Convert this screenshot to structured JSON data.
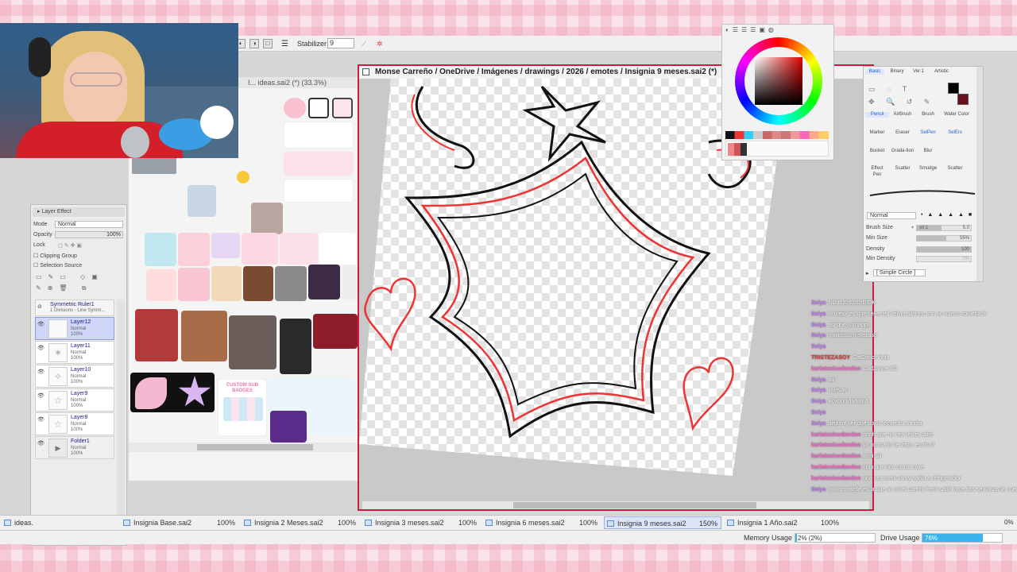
{
  "toolbar": {
    "stabilizer_label": "Stabilizer",
    "stabilizer_value": "9"
  },
  "ideas_window": {
    "title": "I... ideas.sai2 (*) (33.3%)",
    "badge_text": "CUSTOM SUB BADGES"
  },
  "main_window": {
    "title": "Monse Carreño / OneDrive / Imágenes / drawings / 2026 / emotes / Insignia 9 meses.sai2 (*)"
  },
  "layer_panel": {
    "title": "Layer Effect",
    "mode_label": "Mode",
    "mode_value": "Normal",
    "opacity_label": "Opacity",
    "opacity_value": "100%",
    "lock_label": "Lock",
    "clipping_group": "Clipping Group",
    "selection_source": "Selection Source",
    "layers": [
      {
        "name": "Symmetric Ruler1",
        "sub": "1 Divisions - Line Symm..."
      },
      {
        "name": "Layer12",
        "mode": "Normal",
        "opacity": "100%"
      },
      {
        "name": "Layer11",
        "mode": "Normal",
        "opacity": "100%"
      },
      {
        "name": "Layer10",
        "mode": "Normal",
        "opacity": "100%"
      },
      {
        "name": "Layer9",
        "mode": "Normal",
        "opacity": "100%"
      },
      {
        "name": "Layer8",
        "mode": "Normal",
        "opacity": "100%"
      },
      {
        "name": "Folder1",
        "mode": "Normal",
        "opacity": "100%"
      }
    ]
  },
  "tool_panel": {
    "tabs": [
      "Basic",
      "Binary",
      "Ver.1",
      "Artistic"
    ],
    "tools": [
      "Pencil",
      "AirBrush",
      "Brush",
      "Water Color",
      "Marker",
      "Eraser",
      "SelPen",
      "SelErs",
      "Bucket",
      "Grada-tion",
      "Blur",
      "Effect",
      "Scatter",
      "Smudge",
      "Scatter",
      "Pen"
    ],
    "blend_mode": "Normal",
    "brush_size_label": "Brush Size",
    "brush_size_mult": "x0.1",
    "brush_size_value": "5.0",
    "min_size_label": "Min Size",
    "min_size_value": "55%",
    "density_label": "Density",
    "density_value": "100",
    "min_density_label": "Min Density",
    "min_density_value": "0%",
    "shape_value": "[ Simple Circle ]"
  },
  "tabs": [
    {
      "name": "ideas.",
      "zoom": ""
    },
    {
      "name": "Insignia Base.sai2",
      "zoom": "100%"
    },
    {
      "name": "Insignia 2 Meses.sai2",
      "zoom": "100%"
    },
    {
      "name": "Insignia 3 meses.sai2",
      "zoom": "100%"
    },
    {
      "name": "Insignia 6 meses.sai2",
      "zoom": "100%"
    },
    {
      "name": "Insignia 9 meses.sai2",
      "zoom": "150%"
    },
    {
      "name": "Insignia 1 Año.sai2",
      "zoom": "100%"
    }
  ],
  "status": {
    "right_corner": "0%",
    "memory_label": "Memory Usage",
    "memory_value": "2% (2%)",
    "memory_fraction": 0.02,
    "drive_label": "Drive Usage",
    "drive_value": "76%",
    "drive_fraction": 0.76
  },
  "chat": [
    {
      "user": "Seiya",
      "msg": "NDIDJDIDJDIDIDK",
      "color": "#c77dff"
    },
    {
      "user": "Seiya",
      "msg": "lo mejor es que tiene red velvet silenen con un nuevo comeback",
      "color": "#c77dff"
    },
    {
      "user": "Seiya",
      "msg": "asi que yo happy",
      "color": "#c77dff"
    },
    {
      "user": "Seiya",
      "msg": "holiiiissss tristezaso",
      "color": "#c77dff"
    },
    {
      "user": "Seiya",
      "msg": "",
      "color": "#c77dff"
    },
    {
      "user": "TRISTEZASOY",
      "msg": "CatDance hola",
      "color": "#e53935"
    },
    {
      "user": "karlatoxicodandon",
      "msg": "CatDance XD",
      "color": "#ff66cc"
    },
    {
      "user": "Seiya",
      "msg": "aiii",
      "color": "#c77dff"
    },
    {
      "user": "Seiya",
      "msg": "vuelvan",
      "color": "#c77dff"
    },
    {
      "user": "Seiya",
      "msg": "Boxdndidndidnd",
      "color": "#c77dff"
    },
    {
      "user": "Seiya",
      "msg": "",
      "color": "#c77dff"
    },
    {
      "user": "Seiya",
      "msg": "déjame ver que no lo recuerdo ahorita",
      "color": "#c77dff"
    },
    {
      "user": "karlatoxicodandon",
      "msg": "ahhh que no red velvet cake",
      "color": "#ff66cc"
    },
    {
      "user": "karlatoxicodandon",
      "msg": "yo nunca lo he visto, es rico?",
      "color": "#ff66cc"
    },
    {
      "user": "karlatoxicodandon",
      "msg": "a mi siii",
      "color": "#ff66cc"
    },
    {
      "user": "karlatoxicodandon",
      "msg": "com que rico carrot cake",
      "color": "#ff66cc"
    },
    {
      "user": "karlatoxicodandon",
      "msg": "una vez comi uno y sabia a refrigerador",
      "color": "#ff66cc"
    },
    {
      "user": "Seiya",
      "msg": "ay con ortelle es la que no mi el cuento Pero salió hace dos semanas la nueva versión!",
      "color": "#c77dff"
    }
  ],
  "colors": {
    "accent_red": "#d01a40",
    "selection_blue": "#cfd6f7",
    "drive_bar": "#39b5ea"
  }
}
